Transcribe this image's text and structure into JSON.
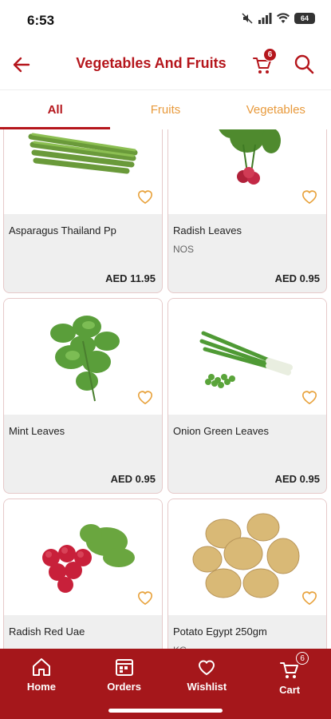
{
  "status_bar": {
    "time": "6:53",
    "battery": "64"
  },
  "header": {
    "title": "Vegetables And Fruits",
    "cart_count": "6"
  },
  "tabs": [
    {
      "label": "All",
      "active": true
    },
    {
      "label": "Fruits",
      "active": false
    },
    {
      "label": "Vegetables",
      "active": false
    }
  ],
  "products": [
    {
      "name": "Asparagus Thailand Pp",
      "sub": "",
      "price": "AED 11.95",
      "image": "asparagus"
    },
    {
      "name": "Radish Leaves",
      "sub": "NOS",
      "price": "AED 0.95",
      "image": "radish-leaves"
    },
    {
      "name": "Mint Leaves",
      "sub": "",
      "price": "AED 0.95",
      "image": "mint"
    },
    {
      "name": "Onion Green Leaves",
      "sub": "",
      "price": "AED 0.95",
      "image": "spring-onion"
    },
    {
      "name": "Radish Red Uae",
      "sub": "",
      "price": "",
      "image": "red-radish"
    },
    {
      "name": "Potato Egypt 250gm",
      "sub": "KG",
      "price": "",
      "image": "potato"
    }
  ],
  "bottom_nav": [
    {
      "label": "Home",
      "icon": "home-icon"
    },
    {
      "label": "Orders",
      "icon": "orders-icon"
    },
    {
      "label": "Wishlist",
      "icon": "heart-icon"
    },
    {
      "label": "Cart",
      "icon": "cart-icon",
      "badge": "6"
    }
  ],
  "colors": {
    "brand": "#b5161c",
    "nav_bg": "#a5171b",
    "tab_inactive": "#e89a3c",
    "heart": "#e8a23c"
  }
}
